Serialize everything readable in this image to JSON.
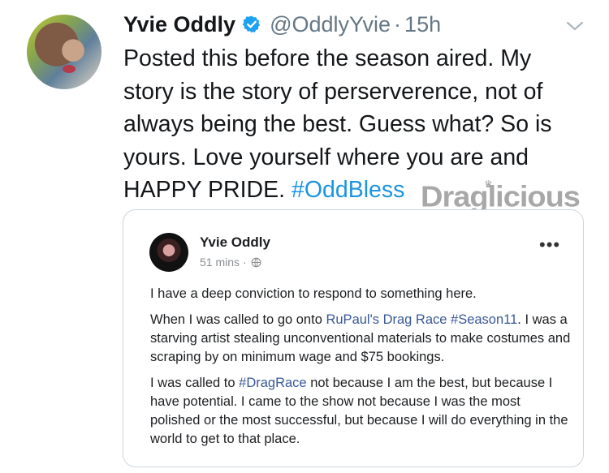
{
  "tweet": {
    "display_name": "Yvie Oddly",
    "handle": "@OddlyYvie",
    "separator": "·",
    "time": "15h",
    "text_lines": [
      "Posted this before the season aired. My",
      "story is the story of perserverence, not of",
      "always being the best. Guess what? So is",
      "yours. Love yourself where you are and",
      "HAPPY PRIDE. "
    ],
    "hashtag": "#OddBless"
  },
  "watermark": "Draglicious",
  "embedded_post": {
    "name": "Yvie Oddly",
    "time": "51 mins",
    "meta_sep": "·",
    "menu_icon": "more-dots-icon",
    "paragraph1": "I have a deep conviction to respond to something here.",
    "paragraph2_a": "When I was called to go onto ",
    "paragraph2_link": "RuPaul's Drag Race #Season11",
    "paragraph2_b": ". I was a starving artist stealing unconventional materials to make costumes and scraping by on minimum wage and $75 bookings.",
    "paragraph3_a": "I was called to ",
    "paragraph3_link": "#DragRace",
    "paragraph3_b": " not because I am the best, but because I have potential. I came to the show not because I was the most polished or the most successful, but because I will do everything in the world to get to that place."
  },
  "colors": {
    "link_blue": "#1b95e0",
    "fb_link": "#385898",
    "muted": "#657786"
  }
}
